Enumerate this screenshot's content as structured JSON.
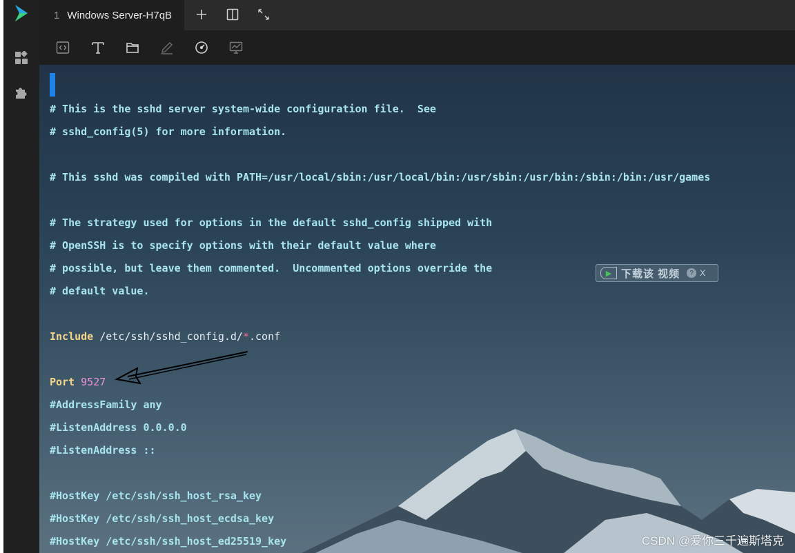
{
  "app": {
    "accent": "#1e82e6"
  },
  "sidebar": {
    "items": [
      {
        "icon": "app-logo-icon"
      },
      {
        "icon": "apps-grid-icon"
      },
      {
        "icon": "plugin-puzzle-icon"
      }
    ]
  },
  "tabs": [
    {
      "index": "1",
      "label": "Windows Server-H7qB",
      "active": true
    }
  ],
  "tab_actions": [
    "plus-icon",
    "split-view-icon",
    "expand-icon"
  ],
  "toolbar": {
    "tools": [
      "code-view-icon",
      "text-tool-icon",
      "folder-icon",
      "edit-pen-icon",
      "speedometer-icon",
      "monitor-chart-icon"
    ]
  },
  "editor": {
    "lines": {
      "l1": "# This is the sshd server system-wide configuration file.  See",
      "l2": "# sshd_config(5) for more information.",
      "l3": "# This sshd was compiled with PATH=/usr/local/sbin:/usr/local/bin:/usr/sbin:/usr/bin:/sbin:/bin:/usr/games",
      "l4": "# The strategy used for options in the default sshd_config shipped with",
      "l5": "# OpenSSH is to specify options with their default value where",
      "l6": "# possible, but leave them commented.  Uncommented options override the",
      "l7": "# default value.",
      "include_kw": "Include",
      "include_path_a": "/etc/ssh/sshd_config.d/",
      "include_star": "*",
      "include_path_b": ".conf",
      "port_kw": "Port",
      "port_value": "9527",
      "l10": "#AddressFamily any",
      "l11": "#ListenAddress 0.0.0.0",
      "l12": "#ListenAddress ::",
      "l13": "#HostKey /etc/ssh/ssh_host_rsa_key",
      "l14": "#HostKey /etc/ssh/ssh_host_ecdsa_key",
      "l15": "#HostKey /etc/ssh/ssh_host_ed25519_key"
    }
  },
  "download_widget": {
    "label": "下载该 视频",
    "help": "?",
    "close": "X"
  },
  "watermark": "CSDN @爱你三千遍斯塔克"
}
